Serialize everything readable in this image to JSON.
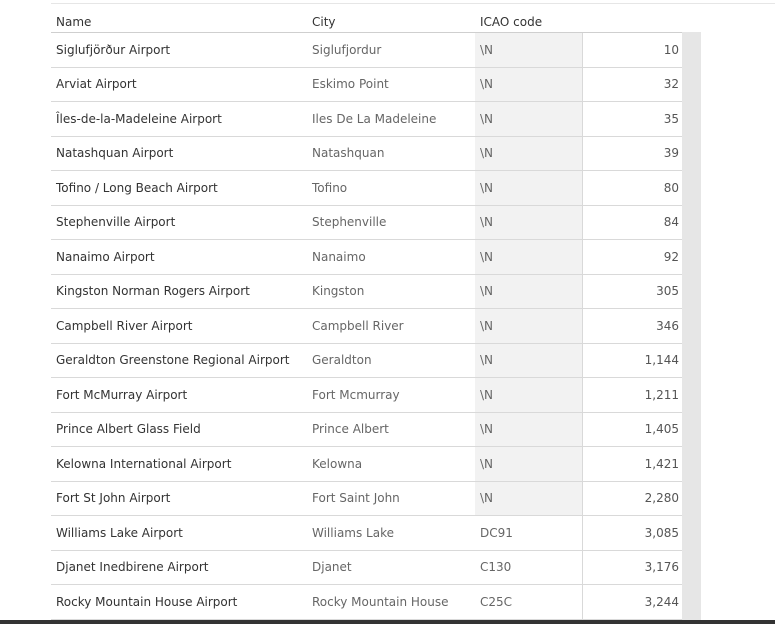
{
  "table": {
    "columns": {
      "name": "Name",
      "city": "City",
      "icao": "ICAO code"
    },
    "rows": [
      {
        "name": "Siglufjörður Airport",
        "city": "Siglufjordur",
        "icao": "\\N",
        "value": "10"
      },
      {
        "name": "Arviat Airport",
        "city": "Eskimo Point",
        "icao": "\\N",
        "value": "32"
      },
      {
        "name": "Îles-de-la-Madeleine Airport",
        "city": "Iles De La Madeleine",
        "icao": "\\N",
        "value": "35"
      },
      {
        "name": "Natashquan Airport",
        "city": "Natashquan",
        "icao": "\\N",
        "value": "39"
      },
      {
        "name": "Tofino / Long Beach Airport",
        "city": "Tofino",
        "icao": "\\N",
        "value": "80"
      },
      {
        "name": "Stephenville Airport",
        "city": "Stephenville",
        "icao": "\\N",
        "value": "84"
      },
      {
        "name": "Nanaimo Airport",
        "city": "Nanaimo",
        "icao": "\\N",
        "value": "92"
      },
      {
        "name": "Kingston Norman Rogers Airport",
        "city": "Kingston",
        "icao": "\\N",
        "value": "305"
      },
      {
        "name": "Campbell River Airport",
        "city": "Campbell River",
        "icao": "\\N",
        "value": "346"
      },
      {
        "name": "Geraldton Greenstone Regional Airport",
        "city": "Geraldton",
        "icao": "\\N",
        "value": "1,144"
      },
      {
        "name": "Fort McMurray Airport",
        "city": "Fort Mcmurray",
        "icao": "\\N",
        "value": "1,211"
      },
      {
        "name": "Prince Albert Glass Field",
        "city": "Prince Albert",
        "icao": "\\N",
        "value": "1,405"
      },
      {
        "name": "Kelowna International Airport",
        "city": "Kelowna",
        "icao": "\\N",
        "value": "1,421"
      },
      {
        "name": "Fort St John Airport",
        "city": "Fort Saint John",
        "icao": "\\N",
        "value": "2,280"
      },
      {
        "name": "Williams Lake Airport",
        "city": "Williams Lake",
        "icao": "DC91",
        "value": "3,085"
      },
      {
        "name": "Djanet Inedbirene Airport",
        "city": "Djanet",
        "icao": "C130",
        "value": "3,176"
      },
      {
        "name": "Rocky Mountain House Airport",
        "city": "Rocky Mountain House",
        "icao": "C25C",
        "value": "3,244"
      }
    ]
  }
}
